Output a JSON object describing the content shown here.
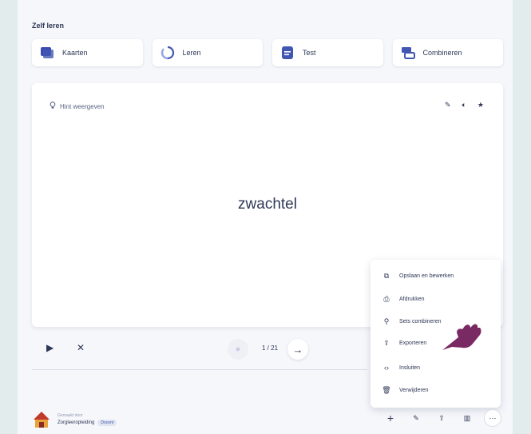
{
  "section_title": "Zelf leren",
  "modes": [
    {
      "label": "Kaarten",
      "icon": "cards-icon",
      "color": "#4257b2"
    },
    {
      "label": "Leren",
      "icon": "learn-cycle-icon",
      "color": "#4257b2"
    },
    {
      "label": "Test",
      "icon": "test-icon",
      "color": "#4257b2"
    },
    {
      "label": "Combineren",
      "icon": "match-icon",
      "color": "#4257b2"
    }
  ],
  "card": {
    "hint_label": "Hint weergeven",
    "term": "zwachtel"
  },
  "controls": {
    "counter": "1 / 21"
  },
  "menu": {
    "items": [
      {
        "label": "Opslaan en bewerken",
        "icon": "copy-icon"
      },
      {
        "label": "Afdrukken",
        "icon": "print-icon"
      },
      {
        "label": "Sets combineren",
        "icon": "merge-icon"
      },
      {
        "label": "Exporteren",
        "icon": "export-icon"
      },
      {
        "label": "Insluiten",
        "icon": "embed-icon"
      },
      {
        "label": "Verwijderen",
        "icon": "trash-icon"
      }
    ]
  },
  "creator": {
    "created_by": "Gemaakt door",
    "name": "Zorgleeropleiding",
    "badge": "Docent"
  },
  "colors": {
    "accent": "#4257b2",
    "hand": "#7a2a63"
  }
}
